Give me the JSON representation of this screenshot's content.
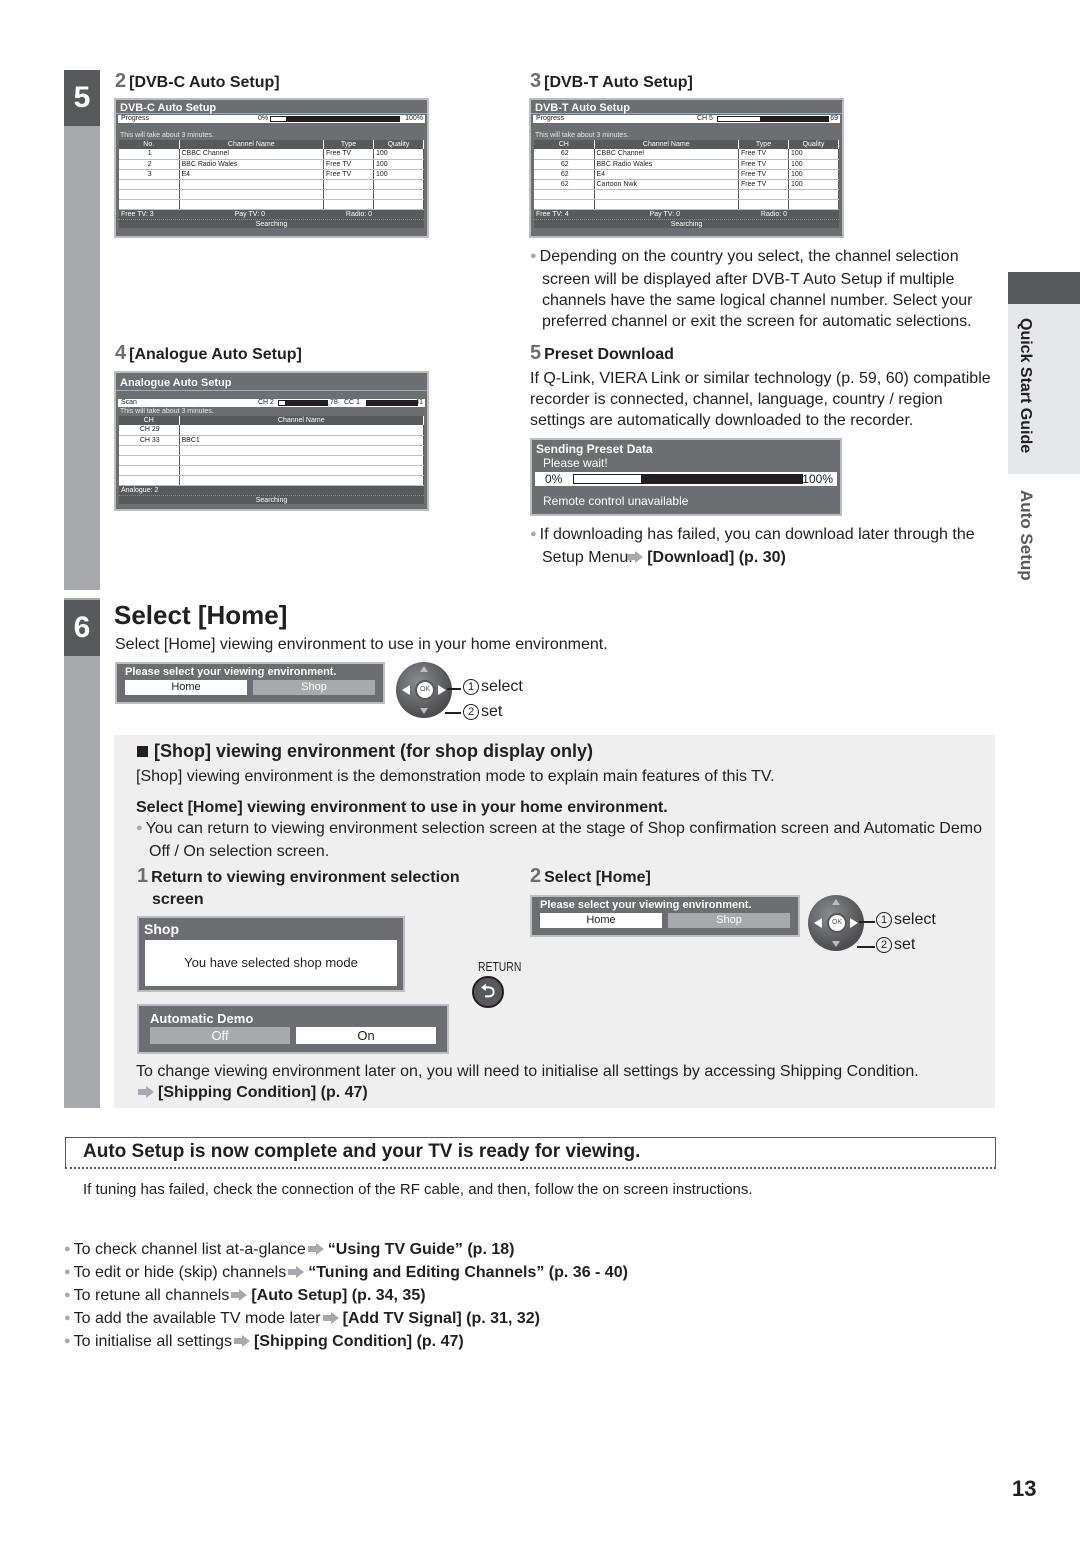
{
  "side_tab": {
    "section": "Quick Start Guide",
    "topic": "Auto Setup"
  },
  "step5": {
    "number": "5",
    "dvbc": {
      "heading_num": "2",
      "heading": "[DVB-C Auto Setup]",
      "screen": {
        "title": "DVB-C Auto Setup",
        "progress_label": "Progress",
        "progress_start": "0%",
        "progress_end": "100%",
        "progress_fraction": 0.12,
        "note": "This will take about 3 minutes.",
        "columns": [
          "No.",
          "Channel Name",
          "Type",
          "Quality"
        ],
        "rows": [
          [
            "1",
            "CBBC Channel",
            "Free TV",
            "100"
          ],
          [
            "2",
            "BBC Radio Wales",
            "Free TV",
            "100"
          ],
          [
            "3",
            "E4",
            "Free TV",
            "100"
          ],
          [
            "",
            "",
            "",
            ""
          ],
          [
            "",
            "",
            "",
            ""
          ],
          [
            "",
            "",
            "",
            ""
          ]
        ],
        "free_tv": "Free TV: 3",
        "pay_tv": "Pay TV: 0",
        "radio": "Radio: 0",
        "status": "Searching"
      }
    },
    "dvbt": {
      "heading_num": "3",
      "heading": "[DVB-T Auto Setup]",
      "screen": {
        "title": "DVB-T Auto Setup",
        "progress_label": "Progress",
        "progress_start": "CH 5",
        "progress_end": "69",
        "progress_fraction": 0.38,
        "note": "This will take about 3 minutes.",
        "columns": [
          "CH",
          "Channel Name",
          "Type",
          "Quality"
        ],
        "rows": [
          [
            "62",
            "CBBC Channel",
            "Free TV",
            "100"
          ],
          [
            "62",
            "BBC Radio Wales",
            "Free TV",
            "100"
          ],
          [
            "62",
            "E4",
            "Free TV",
            "100"
          ],
          [
            "62",
            "Cartoon Nwk",
            "Free TV",
            "100"
          ],
          [
            "",
            "",
            "",
            ""
          ],
          [
            "",
            "",
            "",
            ""
          ]
        ],
        "free_tv": "Free TV: 4",
        "pay_tv": "Pay TV: 0",
        "radio": "Radio: 0",
        "status": "Searching"
      },
      "bullet": "Depending on the country you select, the channel selection screen will be displayed after DVB-T Auto Setup if multiple channels have the same logical channel number. Select your preferred channel or exit the screen for automatic selections."
    },
    "analogue": {
      "heading_num": "4",
      "heading": "[Analogue Auto Setup]",
      "screen": {
        "title": "Analogue Auto Setup",
        "scan_label": "Scan",
        "ch_start": "CH 2",
        "ch_end": "78",
        "ch_fraction": 0.12,
        "cc_start": "CC 1",
        "cc_end": "41",
        "cc_fraction": 0.0,
        "note": "This will take about 3 minutes.",
        "columns": [
          "CH",
          "Channel Name"
        ],
        "rows": [
          [
            "CH 29",
            ""
          ],
          [
            "CH 33",
            "BBC1"
          ],
          [
            "",
            ""
          ],
          [
            "",
            ""
          ],
          [
            "",
            ""
          ],
          [
            "",
            ""
          ]
        ],
        "analogue_count": "Analogue: 2",
        "status": "Searching"
      }
    },
    "preset": {
      "heading_num": "5",
      "heading": "Preset Download",
      "text": "If Q-Link, VIERA Link or similar technology (p. 59, 60) compatible recorder is connected, channel, language, country / region settings are automatically downloaded to the recorder.",
      "screen": {
        "title": "Sending Preset Data",
        "wait": "Please wait!",
        "start": "0%",
        "end": "100%",
        "progress_fraction": 0.3,
        "footer": "Remote control unavailable"
      },
      "bullet_text": "If downloading has failed, you can download later through the Setup Menu.",
      "bullet_link": "[Download] (p. 30)"
    }
  },
  "step6": {
    "number": "6",
    "title": "Select [Home]",
    "subtitle": "Select [Home] viewing environment to use in your home environment.",
    "env_screen": {
      "prompt": "Please select your viewing environment.",
      "home": "Home",
      "shop": "Shop"
    },
    "remote": {
      "ok": "OK",
      "select_num": "1",
      "select": "select",
      "set_num": "2",
      "set": "set"
    },
    "shop_box": {
      "heading": "[Shop] viewing environment (for shop display only)",
      "desc": "[Shop] viewing environment is the demonstration mode to explain main features of this TV.",
      "bold_line": "Select [Home] viewing environment to use in your home environment.",
      "bullet": "You can return to viewing environment selection screen at the stage of Shop confirmation screen and Automatic Demo Off / On selection screen.",
      "sub1_num": "1",
      "sub1": "Return to viewing environment selection screen",
      "shop_screen": {
        "title": "Shop",
        "message": "You have selected shop mode"
      },
      "return_label": "RETURN",
      "demo_screen": {
        "title": "Automatic Demo",
        "off": "Off",
        "on": "On"
      },
      "sub2_num": "2",
      "sub2": "Select [Home]",
      "footer": "To change viewing environment later on, you will need to initialise all settings by accessing Shipping Condition.",
      "footer_link": "[Shipping Condition] (p. 47)"
    }
  },
  "complete": {
    "banner": "Auto Setup is now complete and your TV is ready for viewing.",
    "note": "If tuning has failed, check the connection of the RF cable, and then, follow the on screen instructions."
  },
  "tips": [
    {
      "text": "To check channel list at-a-glance",
      "link": "“Using TV Guide” (p. 18)"
    },
    {
      "text": "To edit or hide (skip) channels",
      "link": "“Tuning and Editing Channels” (p. 36 - 40)"
    },
    {
      "text": "To retune all channels",
      "link": "[Auto Setup] (p. 34, 35)"
    },
    {
      "text": "To add the available TV mode later",
      "link": "[Add TV Signal] (p. 31, 32)"
    },
    {
      "text": "To initialise all settings",
      "link": "[Shipping Condition] (p. 47)"
    }
  ],
  "page_number": "13"
}
